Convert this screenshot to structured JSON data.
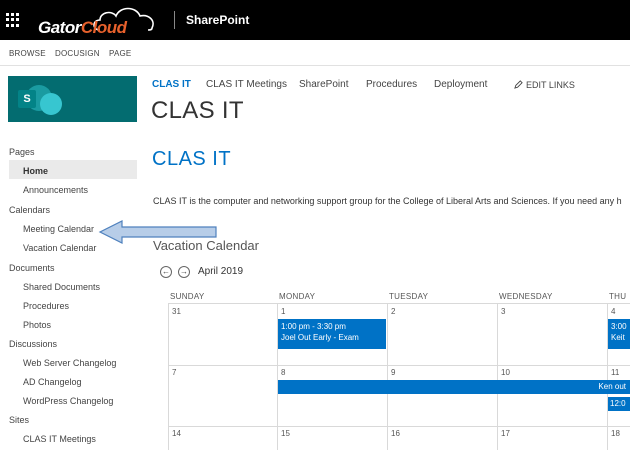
{
  "suitebar": {
    "logo_part1": "Gator",
    "logo_part2": "Cloud",
    "title": "SharePoint"
  },
  "ribbon": {
    "tabs": [
      "BROWSE",
      "DOCUSIGN",
      "PAGE"
    ]
  },
  "site_logo": {
    "letter": "S"
  },
  "topnav": {
    "items": [
      {
        "label": "CLAS IT",
        "active": true
      },
      {
        "label": "CLAS IT Meetings"
      },
      {
        "label": "SharePoint"
      },
      {
        "label": "Procedures"
      },
      {
        "label": "Deployment"
      }
    ],
    "edit_links": "EDIT LINKS"
  },
  "site_title": "CLAS IT",
  "leftnav": {
    "pages": "Pages",
    "home": "Home",
    "announcements": "Announcements",
    "calendars": "Calendars",
    "meeting_calendar": "Meeting Calendar",
    "vacation_calendar": "Vacation Calendar",
    "documents": "Documents",
    "shared_documents": "Shared Documents",
    "procedures": "Procedures",
    "photos": "Photos",
    "discussions": "Discussions",
    "web_server_changelog": "Web Server Changelog",
    "ad_changelog": "AD Changelog",
    "wordpress_changelog": "WordPress Changelog",
    "sites": "Sites",
    "clas_it_meetings": "CLAS IT Meetings"
  },
  "main": {
    "heading": "CLAS IT",
    "intro": "CLAS IT is the computer and networking support group for the College of Liberal Arts and Sciences. If you need any h",
    "calendar_title": "Vacation Calendar",
    "month": "April 2019",
    "prev_glyph": "←",
    "next_glyph": "→"
  },
  "calendar": {
    "days": [
      "SUNDAY",
      "MONDAY",
      "TUESDAY",
      "WEDNESDAY",
      "THU"
    ],
    "week1": [
      "31",
      "1",
      "2",
      "3",
      "4"
    ],
    "week2": [
      "7",
      "8",
      "9",
      "10",
      "11"
    ],
    "week3": [
      "14",
      "15",
      "16",
      "17",
      "18"
    ],
    "events": {
      "mon_time": "1:00 pm - 3:30 pm",
      "mon_title": "Joel Out Early - Exam",
      "thu_time": "3:00",
      "thu_title": "Keit",
      "ken": "Ken out",
      "thu2_time": "12:0"
    },
    "accent": "#0072c6"
  }
}
